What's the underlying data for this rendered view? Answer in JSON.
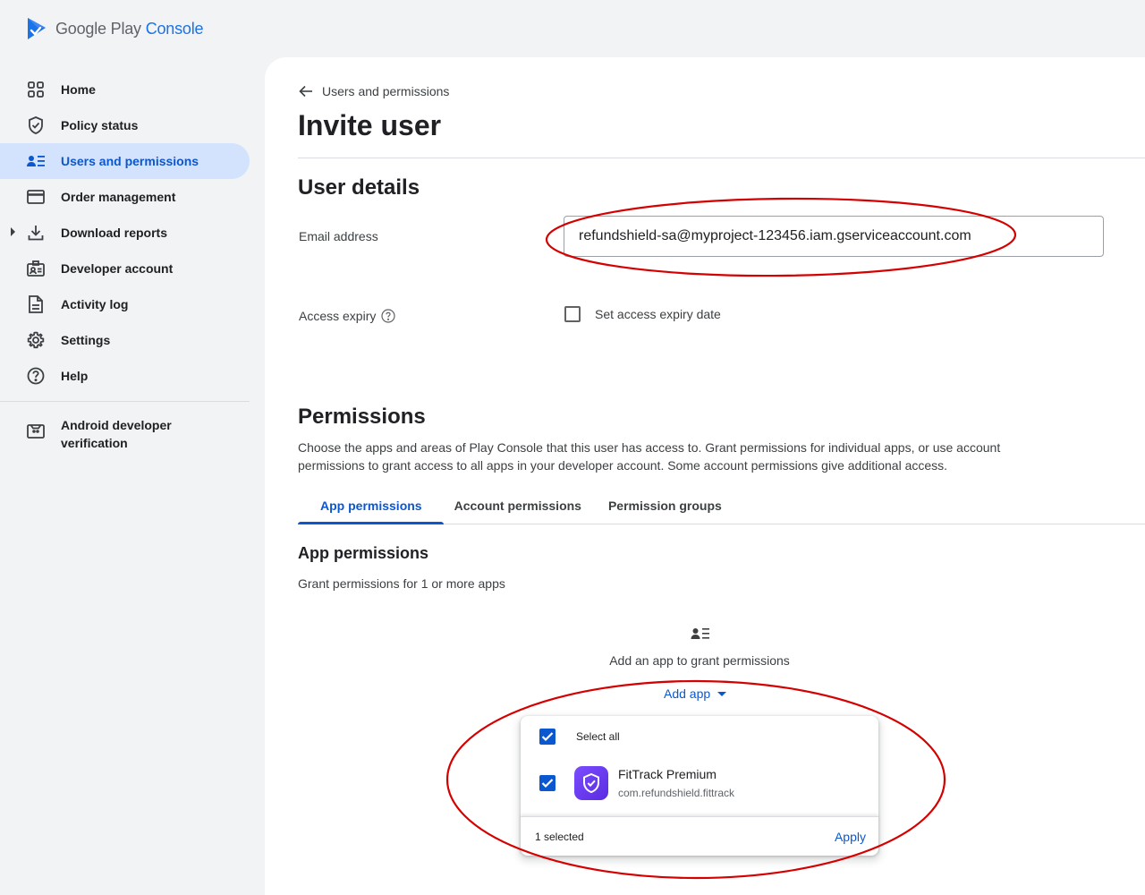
{
  "header": {
    "brand_google": "Google Play",
    "brand_console": "Console"
  },
  "sidebar": {
    "items": [
      {
        "label": "Home",
        "icon": "grid-icon"
      },
      {
        "label": "Policy status",
        "icon": "shield-icon"
      },
      {
        "label": "Users and permissions",
        "icon": "users-icon",
        "active": true
      },
      {
        "label": "Order management",
        "icon": "credit-card-icon"
      },
      {
        "label": "Download reports",
        "icon": "download-icon"
      },
      {
        "label": "Developer account",
        "icon": "id-badge-icon"
      },
      {
        "label": "Activity log",
        "icon": "document-icon"
      },
      {
        "label": "Settings",
        "icon": "gear-icon"
      },
      {
        "label": "Help",
        "icon": "help-icon"
      },
      {
        "label": "Android developer verification",
        "icon": "android-icon"
      }
    ]
  },
  "main": {
    "breadcrumb": "Users and permissions",
    "title": "Invite user",
    "user_details": {
      "heading": "User details",
      "email_label": "Email address",
      "email_value": "refundshield-sa@myproject-123456.iam.gserviceaccount.com",
      "expiry_label": "Access expiry",
      "expiry_checkbox_label": "Set access expiry date",
      "expiry_checked": false
    },
    "permissions": {
      "heading": "Permissions",
      "description": "Choose the apps and areas of Play Console that this user has access to. Grant permissions for individual apps, or use account permissions to grant access to all apps in your developer account. Some account permissions give additional access.",
      "tabs": [
        "App permissions",
        "Account permissions",
        "Permission groups"
      ],
      "active_tab": "App permissions",
      "app_permissions_heading": "App permissions",
      "app_permissions_sub": "Grant permissions for 1 or more apps",
      "empty_text": "Add an app to grant permissions",
      "add_app_label": "Add app"
    },
    "app_dropdown": {
      "select_all_label": "Select all",
      "select_all_checked": true,
      "apps": [
        {
          "name": "FitTrack Premium",
          "package": "com.refundshield.fittrack",
          "checked": true
        }
      ],
      "selected_text": "1 selected",
      "apply_label": "Apply"
    }
  },
  "colors": {
    "accent": "#0b57d0",
    "active_nav_bg": "#d3e3fd",
    "annotation": "#d50000"
  }
}
